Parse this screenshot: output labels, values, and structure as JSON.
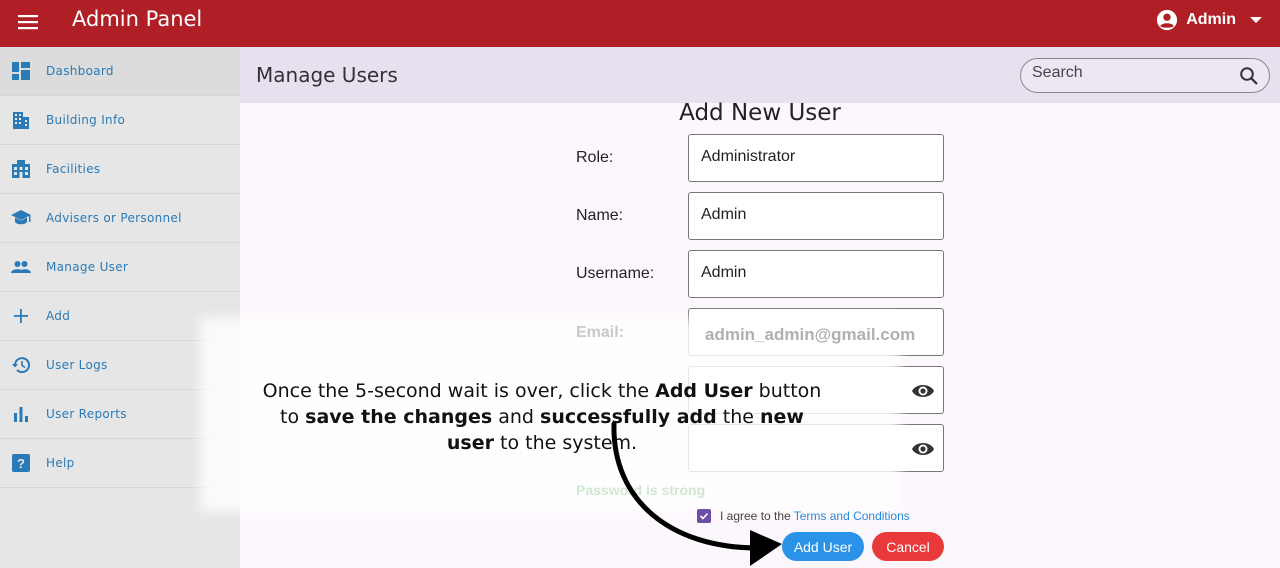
{
  "app": {
    "title": "Admin Panel",
    "user": "Admin"
  },
  "sidebar": {
    "items": [
      {
        "label": "Dashboard",
        "icon": "dashboard-icon"
      },
      {
        "label": "Building Info",
        "icon": "building-icon"
      },
      {
        "label": "Facilities",
        "icon": "facilities-icon"
      },
      {
        "label": "Advisers or Personnel",
        "icon": "school-icon"
      },
      {
        "label": "Manage User",
        "icon": "people-icon"
      },
      {
        "label": "Add",
        "icon": "plus-icon"
      },
      {
        "label": "User Logs",
        "icon": "history-icon"
      },
      {
        "label": "User Reports",
        "icon": "bar-chart-icon"
      },
      {
        "label": "Help",
        "icon": "help-icon"
      }
    ]
  },
  "header": {
    "title": "Manage Users",
    "search_placeholder": "Search"
  },
  "form": {
    "title": "Add New User",
    "role_label": "Role:",
    "role_value": "Administrator",
    "name_label": "Name:",
    "name_value": "Admin",
    "username_label": "Username:",
    "username_value": "Admin",
    "email_label": "Email:",
    "email_value": "admin_admin@gmail.com",
    "password_hint": "Password is strong",
    "agree_text": "I agree to the",
    "terms_link": "Terms and Conditions",
    "add_button": "Add User",
    "cancel_button": "Cancel"
  },
  "caption": {
    "part1": "Once the 5-second wait is over, click the ",
    "bold1": "Add User",
    "part2": " button to ",
    "bold2": "save the changes",
    "part3": " and ",
    "bold3": "successfully add",
    "part4": " the ",
    "bold4": "new user",
    "part5": " to the system."
  },
  "colors": {
    "brand": "#b01e26",
    "accent": "#2a93e8",
    "danger": "#e83a3a",
    "checkbox": "#6d4fa6"
  }
}
